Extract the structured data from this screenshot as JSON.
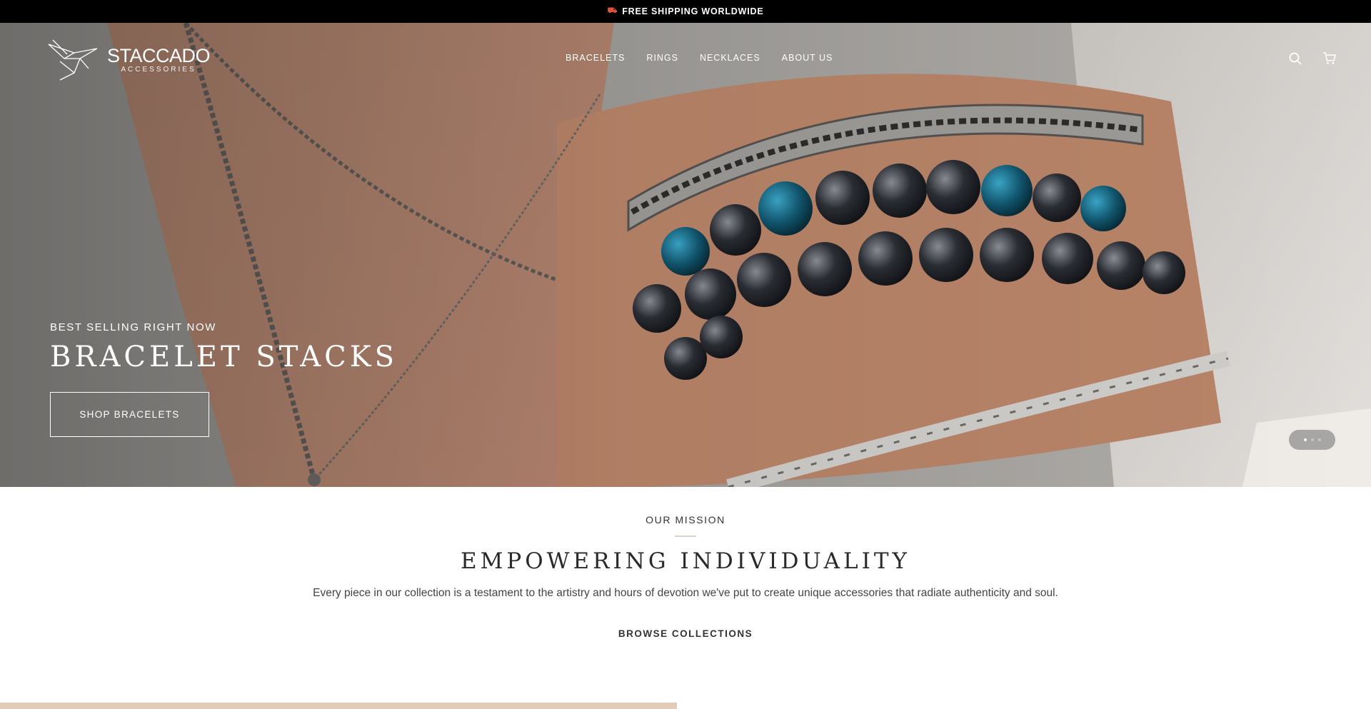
{
  "announcement": {
    "icon": "truck-icon",
    "text": "FREE SHIPPING WORLDWIDE"
  },
  "header": {
    "brand": "STACCADO",
    "brand_sub": "ACCESSORIES",
    "nav": [
      "BRACELETS",
      "RINGS",
      "NECKLACES",
      "ABOUT US"
    ],
    "icons": [
      "search-icon",
      "cart-icon"
    ]
  },
  "hero": {
    "kicker": "BEST SELLING RIGHT NOW",
    "headline": "BRACELET STACKS",
    "button_label": "SHOP BRACELETS"
  },
  "mission": {
    "kicker": "OUR MISSION",
    "title": "EMPOWERING INDIVIDUALITY",
    "body": "Every piece in our collection is a testament to the artistry and hours of devotion we've put to create unique accessories that radiate authenticity and soul.",
    "cta": "BROWSE COLLECTIONS"
  },
  "colors": {
    "announce_bg": "#000000",
    "accent_truck": "#e0533a",
    "strip": "#e2ccb7"
  }
}
